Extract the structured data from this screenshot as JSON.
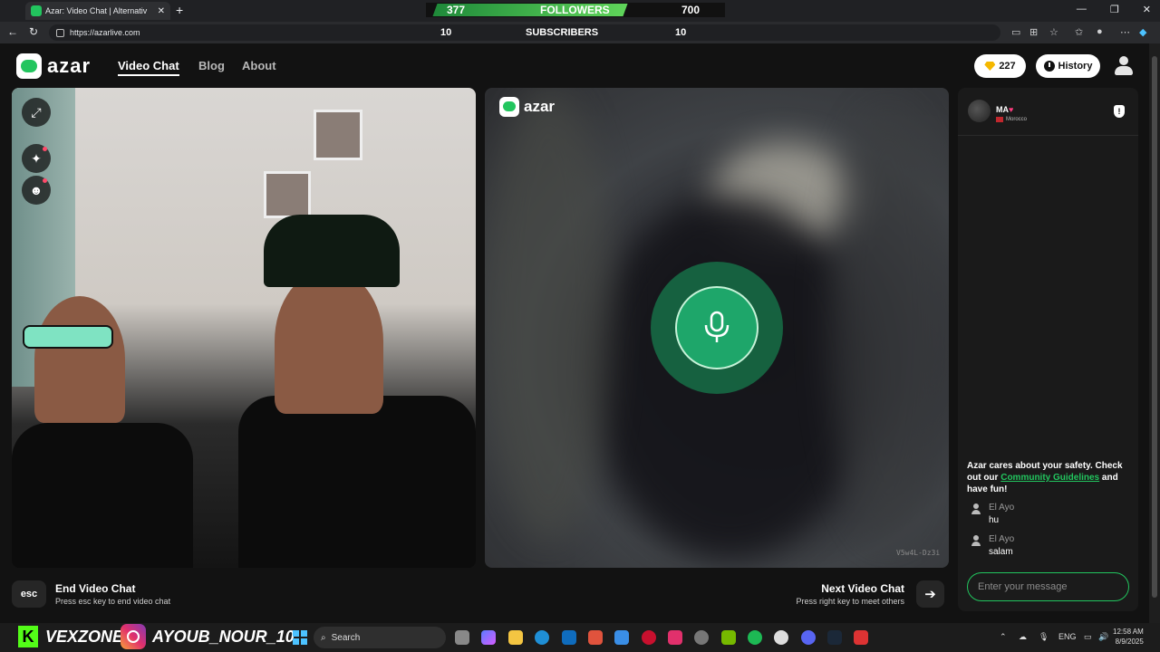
{
  "browser": {
    "tab_title": "Azar: Video Chat | Alternativ",
    "url": "https://azarlive.com"
  },
  "overlay": {
    "followers_count": "377",
    "followers_label": "FOLLOWERS",
    "followers_goal": "700",
    "subscribers_count": "10",
    "subscribers_label": "SUBSCRIBERS",
    "subscribers_goal": "10"
  },
  "header": {
    "logo": "azar",
    "nav": [
      "Video Chat",
      "Blog",
      "About"
    ],
    "gems": "227",
    "history": "History"
  },
  "remote": {
    "logo": "azar",
    "watermark": "V5w4L-Dz3i"
  },
  "chat": {
    "partner_name": "MA",
    "partner_country": "Morocco",
    "safety_pre": "Azar cares about your safety. Check out our ",
    "safety_link": "Community Guidelines",
    "safety_post": " and have fun!",
    "messages": [
      {
        "name": "El Ayo",
        "text": "hu"
      },
      {
        "name": "El Ayo",
        "text": "salam"
      }
    ],
    "placeholder": "Enter your message"
  },
  "controls": {
    "esc_key": "esc",
    "end_title": "End Video Chat",
    "end_sub": "Press esc key to end video chat",
    "next_title": "Next Video Chat",
    "next_sub": "Press right key to meet others"
  },
  "taskbar": {
    "kick_name": "VEXZONE",
    "ig_name": "AYOUB_NOUR_10",
    "search": "Search",
    "lang": "ENG",
    "time": "12:58 AM",
    "date": "8/9/2025"
  },
  "colors": {
    "accent": "#22c55e",
    "background": "#121212",
    "heart": "#ff3d7f"
  }
}
